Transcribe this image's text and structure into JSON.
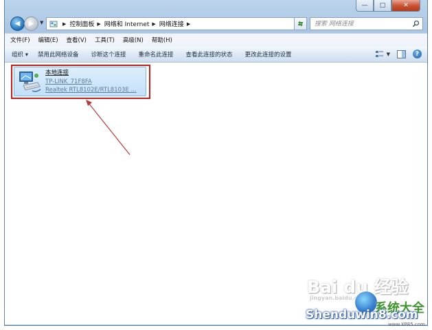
{
  "window": {
    "caption_buttons": {
      "minimize": "—",
      "maximize": "□",
      "close": "✕"
    }
  },
  "address": {
    "breadcrumbs": [
      "控制面板",
      "网络和 Internet",
      "网络连接"
    ],
    "search_placeholder": "搜索 网络连接"
  },
  "menu": [
    "文件(F)",
    "编辑(E)",
    "查看(V)",
    "工具(T)",
    "高级(N)",
    "帮助(H)"
  ],
  "commands": {
    "organize": "组织 ▾",
    "items": [
      "禁用此网络设备",
      "诊断这个连接",
      "重命名此连接",
      "查看此连接的状态",
      "更改此连接的设置"
    ]
  },
  "connection": {
    "name": "本地连接",
    "network": "TP-LINK_71F8FA",
    "adapter": "Realtek RTL8102E/RTL8103E ..."
  },
  "watermark": {
    "baidu": "Bai du 经验",
    "baidu_sub": "jingyan.baidu.com",
    "brand_cn": "系统大全",
    "brand": "Shenduwin8.com",
    "site": "www.XP85.com"
  },
  "colors": {
    "highlight": "#c21e1e",
    "frame": "#a9c4e3",
    "selection": "#c4e0f8"
  }
}
